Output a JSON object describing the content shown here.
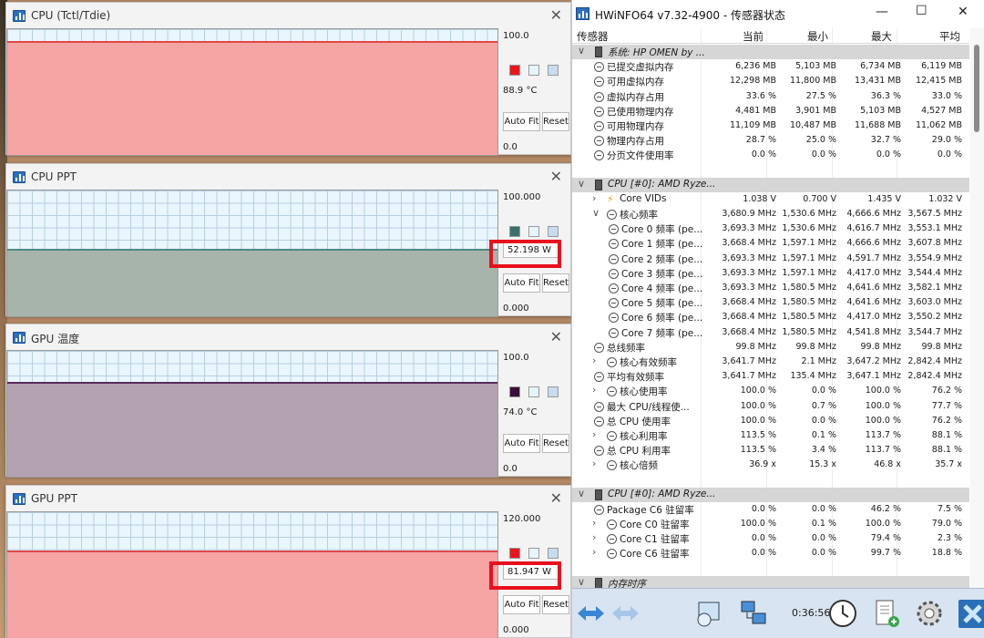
{
  "graphs": [
    {
      "title": "CPU (Tctl/Tdie)",
      "max": "100.0",
      "min": "0.0",
      "current": "88.9 °C",
      "level": 0.89,
      "color": "#f7a4a4",
      "edge": "#e04848",
      "swatch": "#e8161c",
      "highlight": false,
      "auto_fit": "Auto Fit",
      "reset": "Reset"
    },
    {
      "title": "CPU PPT",
      "max": "100.000",
      "min": "0.000",
      "current": "52.198 W",
      "level": 0.52,
      "color": "#a7b4ab",
      "edge": "#4e8a85",
      "swatch": "#3b6f6a",
      "highlight": true,
      "auto_fit": "Auto Fit",
      "reset": "Reset"
    },
    {
      "title": "GPU 温度",
      "max": "100.0",
      "min": "0.0",
      "current": "74.0 °C",
      "level": 0.74,
      "color": "#b3a2b1",
      "edge": "#5a2b5a",
      "swatch": "#3a0f3a",
      "highlight": false,
      "auto_fit": "Auto Fit",
      "reset": "Reset"
    },
    {
      "title": "GPU PPT",
      "max": "120.000",
      "min": "0.000",
      "current": "81.947 W",
      "level": 0.68,
      "color": "#f7a4a4",
      "edge": "#e04848",
      "swatch": "#e8161c",
      "highlight": true,
      "auto_fit": "Auto Fit",
      "reset": "Reset"
    }
  ],
  "hwinfo": {
    "title": "HWiNFO64 v7.32-4900 - 传感器状态",
    "columns": [
      "传感器",
      "当前",
      "最小",
      "最大",
      "平均"
    ],
    "rows": [
      {
        "type": "group",
        "indent": 0,
        "chev": "∨",
        "name": "系统: HP OMEN by ..."
      },
      {
        "indent": 1,
        "name": "已提交虚拟内存",
        "v": [
          "6,236 MB",
          "5,103 MB",
          "6,734 MB",
          "6,119 MB"
        ]
      },
      {
        "indent": 1,
        "name": "可用虚拟内存",
        "v": [
          "12,298 MB",
          "11,800 MB",
          "13,431 MB",
          "12,415 MB"
        ]
      },
      {
        "indent": 1,
        "name": "虚拟内存占用",
        "v": [
          "33.6 %",
          "27.5 %",
          "36.3 %",
          "33.0 %"
        ]
      },
      {
        "indent": 1,
        "name": "已使用物理内存",
        "v": [
          "4,481 MB",
          "3,901 MB",
          "5,103 MB",
          "4,527 MB"
        ]
      },
      {
        "indent": 1,
        "name": "可用物理内存",
        "v": [
          "11,109 MB",
          "10,487 MB",
          "11,688 MB",
          "11,062 MB"
        ]
      },
      {
        "indent": 1,
        "name": "物理内存占用",
        "v": [
          "28.7 %",
          "25.0 %",
          "32.7 %",
          "29.0 %"
        ]
      },
      {
        "indent": 1,
        "name": "分页文件使用率",
        "v": [
          "0.0 %",
          "0.0 %",
          "0.0 %",
          "0.0 %"
        ]
      },
      {
        "type": "blank"
      },
      {
        "type": "group",
        "indent": 0,
        "chev": "∨",
        "name": "CPU [#0]: AMD Ryze..."
      },
      {
        "indent": 1,
        "chev": "›",
        "icon": "bolt",
        "name": "Core VIDs",
        "v": [
          "1.038 V",
          "0.700 V",
          "1.435 V",
          "1.032 V"
        ]
      },
      {
        "indent": 1,
        "chev": "∨",
        "name": "核心频率",
        "v": [
          "3,680.9 MHz",
          "1,530.6 MHz",
          "4,666.6 MHz",
          "3,567.5 MHz"
        ]
      },
      {
        "indent": 2,
        "name": "Core 0 频率 (pe...",
        "v": [
          "3,693.3 MHz",
          "1,530.6 MHz",
          "4,616.7 MHz",
          "3,553.1 MHz"
        ]
      },
      {
        "indent": 2,
        "name": "Core 1 频率 (pe...",
        "v": [
          "3,668.4 MHz",
          "1,597.1 MHz",
          "4,666.6 MHz",
          "3,607.8 MHz"
        ]
      },
      {
        "indent": 2,
        "name": "Core 2 频率 (pe...",
        "v": [
          "3,693.3 MHz",
          "1,597.1 MHz",
          "4,591.7 MHz",
          "3,554.9 MHz"
        ]
      },
      {
        "indent": 2,
        "name": "Core 3 频率 (pe...",
        "v": [
          "3,693.3 MHz",
          "1,597.1 MHz",
          "4,417.0 MHz",
          "3,544.4 MHz"
        ]
      },
      {
        "indent": 2,
        "name": "Core 4 频率 (pe...",
        "v": [
          "3,693.3 MHz",
          "1,580.5 MHz",
          "4,641.6 MHz",
          "3,582.1 MHz"
        ]
      },
      {
        "indent": 2,
        "name": "Core 5 频率 (pe...",
        "v": [
          "3,668.4 MHz",
          "1,580.5 MHz",
          "4,641.6 MHz",
          "3,603.0 MHz"
        ]
      },
      {
        "indent": 2,
        "name": "Core 6 频率 (pe...",
        "v": [
          "3,668.4 MHz",
          "1,580.5 MHz",
          "4,417.0 MHz",
          "3,550.2 MHz"
        ]
      },
      {
        "indent": 2,
        "name": "Core 7 频率 (pe...",
        "v": [
          "3,668.4 MHz",
          "1,580.5 MHz",
          "4,541.8 MHz",
          "3,544.7 MHz"
        ]
      },
      {
        "indent": 1,
        "name": "总线频率",
        "v": [
          "99.8 MHz",
          "99.8 MHz",
          "99.8 MHz",
          "99.8 MHz"
        ]
      },
      {
        "indent": 1,
        "chev": "›",
        "name": "核心有效频率",
        "v": [
          "3,641.7 MHz",
          "2.1 MHz",
          "3,647.2 MHz",
          "2,842.4 MHz"
        ]
      },
      {
        "indent": 1,
        "name": "平均有效频率",
        "v": [
          "3,641.7 MHz",
          "135.4 MHz",
          "3,647.1 MHz",
          "2,842.4 MHz"
        ]
      },
      {
        "indent": 1,
        "chev": "›",
        "name": "核心使用率",
        "v": [
          "100.0 %",
          "0.0 %",
          "100.0 %",
          "76.2 %"
        ]
      },
      {
        "indent": 1,
        "name": "最大 CPU/线程使...",
        "v": [
          "100.0 %",
          "0.7 %",
          "100.0 %",
          "77.7 %"
        ]
      },
      {
        "indent": 1,
        "name": "总 CPU 使用率",
        "v": [
          "100.0 %",
          "0.0 %",
          "100.0 %",
          "76.2 %"
        ]
      },
      {
        "indent": 1,
        "chev": "›",
        "name": "核心利用率",
        "v": [
          "113.5 %",
          "0.1 %",
          "113.7 %",
          "88.1 %"
        ]
      },
      {
        "indent": 1,
        "name": "总 CPU 利用率",
        "v": [
          "113.5 %",
          "3.4 %",
          "113.7 %",
          "88.1 %"
        ]
      },
      {
        "indent": 1,
        "chev": "›",
        "name": "核心倍频",
        "v": [
          "36.9 x",
          "15.3 x",
          "46.8 x",
          "35.7 x"
        ]
      },
      {
        "type": "blank"
      },
      {
        "type": "group",
        "indent": 0,
        "chev": "∨",
        "name": "CPU [#0]: AMD Ryze..."
      },
      {
        "indent": 1,
        "name": "Package C6 驻留率",
        "v": [
          "0.0 %",
          "0.0 %",
          "46.2 %",
          "7.5 %"
        ]
      },
      {
        "indent": 1,
        "chev": "›",
        "name": "Core C0 驻留率",
        "v": [
          "100.0 %",
          "0.1 %",
          "100.0 %",
          "79.0 %"
        ]
      },
      {
        "indent": 1,
        "chev": "›",
        "name": "Core C1 驻留率",
        "v": [
          "0.0 %",
          "0.0 %",
          "79.4 %",
          "2.3 %"
        ]
      },
      {
        "indent": 1,
        "chev": "›",
        "name": "Core C6 驻留率",
        "v": [
          "0.0 %",
          "0.0 %",
          "99.7 %",
          "18.8 %"
        ]
      },
      {
        "type": "blank"
      },
      {
        "type": "group",
        "indent": 0,
        "chev": "∨",
        "name": "内存时序"
      }
    ],
    "timer": "0:36:56",
    "icons": [
      "nav-lr-icon",
      "nav-lr-disabled-icon",
      "summary-icon",
      "network-icon",
      "clock-icon",
      "report-icon",
      "settings-icon",
      "close-app-icon"
    ]
  }
}
